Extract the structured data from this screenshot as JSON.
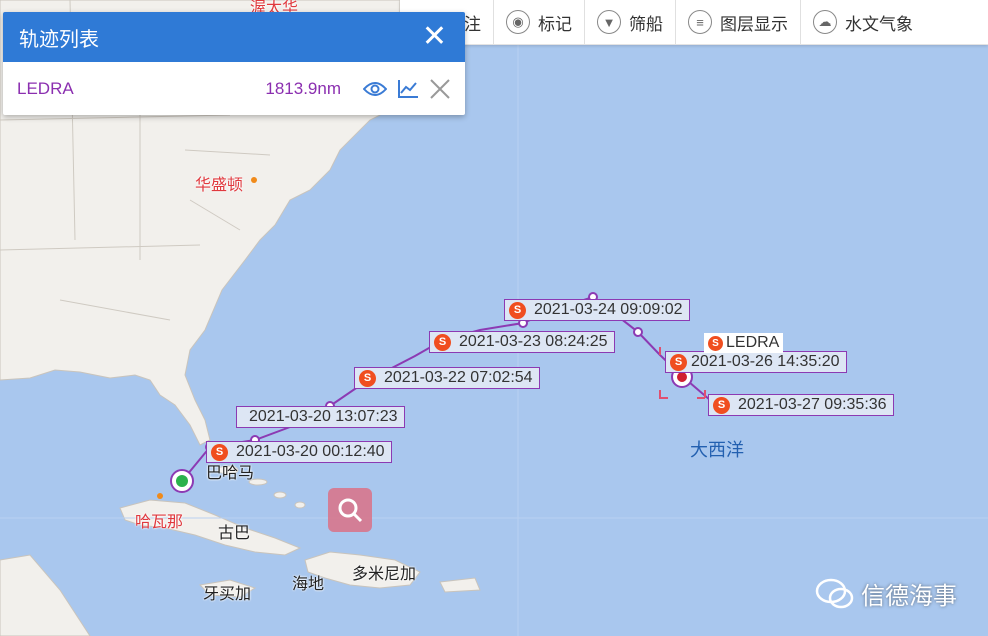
{
  "toolbar": {
    "items": [
      {
        "label": "注",
        "icon": "annotate-icon"
      },
      {
        "label": "标记",
        "icon": "tag-icon"
      },
      {
        "label": "筛船",
        "icon": "filter-icon"
      },
      {
        "label": "图层显示",
        "icon": "layers-icon"
      },
      {
        "label": "水文气象",
        "icon": "weather-icon"
      }
    ]
  },
  "panel": {
    "title": "轨迹列表",
    "row": {
      "name": "LEDRA",
      "distance": "1813.9nm"
    }
  },
  "track_labels": [
    "2021-03-20 00:12:40",
    "2021-03-20 13:07:23",
    "2021-03-22 07:02:54",
    "2021-03-23 08:24:25",
    "2021-03-24 09:09:02",
    "2021-03-26 14:35:20",
    "2021-03-27 09:35:36"
  ],
  "ship": {
    "name": "LEDRA",
    "badge": "S"
  },
  "places": {
    "washington": "华盛顿",
    "bahamas": "巴哈马",
    "havana": "哈瓦那",
    "cuba": "古巴",
    "jamaica": "牙买加",
    "haiti": "海地",
    "dominican": "多米尼加",
    "atlantic": "大西洋",
    "top_partial": "渥太华"
  },
  "watermark": "信德海事",
  "colors": {
    "track": "#8c3ab3",
    "header": "#2f7ad6",
    "badge": "#f04e1f"
  }
}
